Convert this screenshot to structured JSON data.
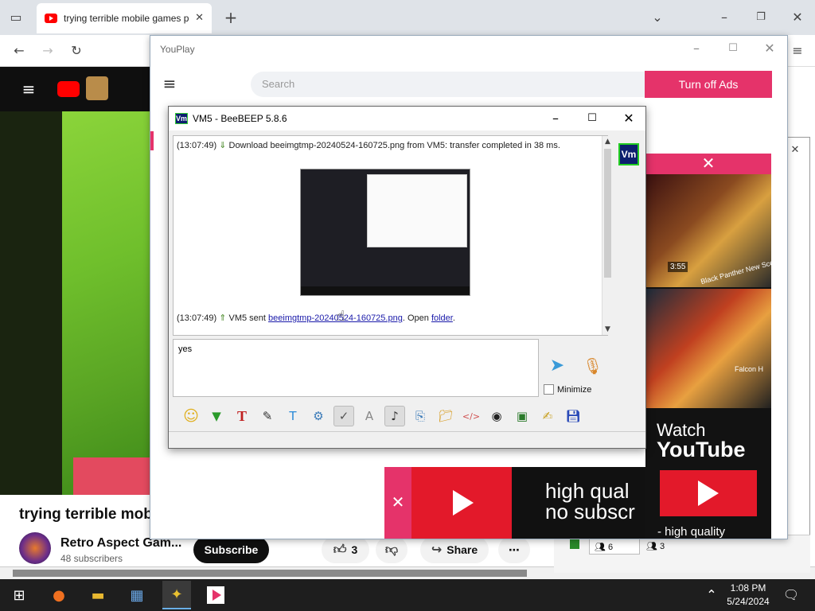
{
  "browser": {
    "tab_title": "trying terrible mobile games pt",
    "new_tab": "+",
    "yt_channel": {
      "video_title": "trying terrible mobi",
      "channel_name": "Retro Aspect Gam...",
      "subscribers": "48 subscribers",
      "subscribe_label": "Subscribe",
      "likes": "3",
      "share_label": "Share",
      "more_label": "⋯"
    }
  },
  "youplay": {
    "title": "YouPlay",
    "search_placeholder": "Search",
    "ads_button": "Turn off Ads",
    "close_x": "✕",
    "watch_line1": "Watch",
    "watch_line2": "YouTube",
    "hq_text": "- high quality",
    "banner_line1": "high qual",
    "banner_line2": "no subscr",
    "thumb1_duration": "3:55",
    "thumb1_caption": "Black Panther New Sce",
    "thumb2_caption": "Falcon H"
  },
  "beebeep": {
    "title": "VM5 - BeeBEEP 5.8.6",
    "vm_badge": "Vm",
    "msg1_time": "(13:07:49)",
    "msg1_text": "Download beeimgtmp-20240524-160725.png from VM5: transfer completed in 38 ms.",
    "msg2_time": "(13:07:49)",
    "msg2_prefix": "VM5 sent",
    "msg2_link": "beeimgtmp-20240524-160725.png",
    "msg2_open": ". Open",
    "msg2_folder": "folder",
    "msg2_end": ".",
    "input_value": "yes",
    "minimize_label": "Minimize"
  },
  "sidepanel": {
    "count1": "6",
    "count2": "3"
  },
  "taskbar": {
    "time": "1:08 PM",
    "date": "5/24/2024"
  }
}
